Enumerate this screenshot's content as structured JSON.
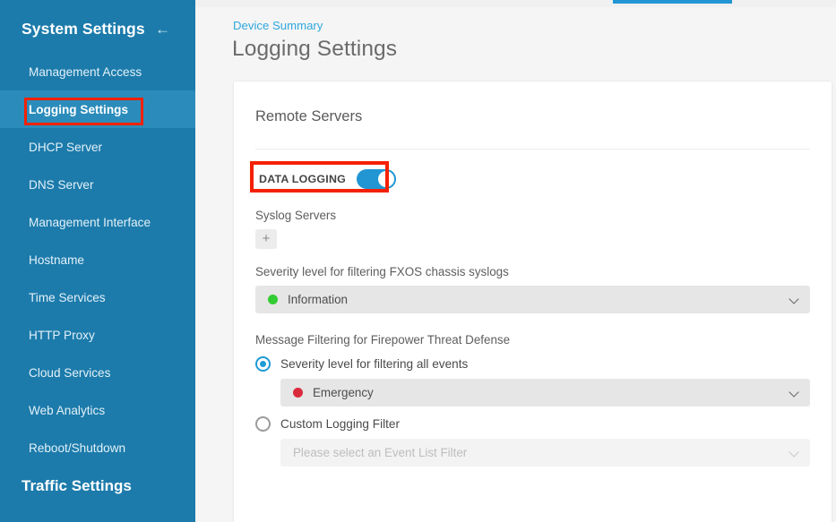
{
  "sidebar": {
    "title": "System Settings",
    "back_icon": "arrow-left-icon",
    "items": [
      {
        "label": "Management Access",
        "active": false
      },
      {
        "label": "Logging Settings",
        "active": true
      },
      {
        "label": "DHCP Server",
        "active": false
      },
      {
        "label": "DNS Server",
        "active": false
      },
      {
        "label": "Management Interface",
        "active": false
      },
      {
        "label": "Hostname",
        "active": false
      },
      {
        "label": "Time Services",
        "active": false
      },
      {
        "label": "HTTP Proxy",
        "active": false
      },
      {
        "label": "Cloud Services",
        "active": false
      },
      {
        "label": "Web Analytics",
        "active": false
      },
      {
        "label": "Reboot/Shutdown",
        "active": false
      }
    ],
    "group_title": "Traffic Settings"
  },
  "header": {
    "breadcrumb": "Device Summary",
    "page_title": "Logging Settings"
  },
  "card": {
    "title": "Remote Servers",
    "data_logging": {
      "label": "DATA LOGGING",
      "enabled": true
    },
    "syslog_servers": {
      "label": "Syslog Servers",
      "add_button_icon": "plus-icon",
      "add_button_label": "+"
    },
    "fxos_severity": {
      "label": "Severity level for filtering FXOS chassis syslogs",
      "value": "Information",
      "dot_color": "#33cc33",
      "chevron_icon": "chevron-down-icon"
    },
    "message_filtering": {
      "label": "Message Filtering for Firepower Threat Defense",
      "options": [
        {
          "label": "Severity level for filtering all events",
          "selected": true,
          "dropdown": {
            "value": "Emergency",
            "dot_color": "#d92b3c",
            "disabled": false,
            "chevron_icon": "chevron-down-icon"
          }
        },
        {
          "label": "Custom Logging Filter",
          "selected": false,
          "dropdown": {
            "value": "Please select an Event List Filter",
            "dot_color": null,
            "disabled": true,
            "chevron_icon": "chevron-down-icon"
          }
        }
      ]
    }
  },
  "annotations": {
    "highlight_color": "#f42105",
    "nav_highlight_target": "Logging Settings",
    "toggle_highlight_target": "DATA LOGGING"
  },
  "accent": {
    "sidebar_bg": "#1c7bab",
    "sidebar_active_bg": "#2b8cbb",
    "link_blue": "#2fa8dd",
    "toggle_blue": "#2196d3"
  }
}
